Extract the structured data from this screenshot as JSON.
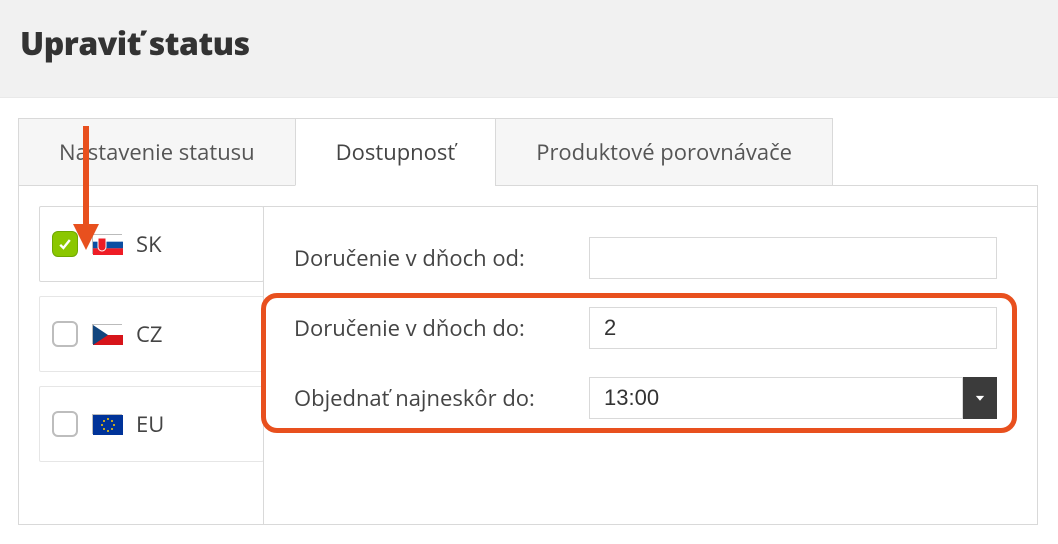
{
  "header": {
    "title": "Upraviť status"
  },
  "tabs": {
    "status": {
      "label": "Nastavenie statusu",
      "active": false
    },
    "avail": {
      "label": "Dostupnosť",
      "active": true
    },
    "compare": {
      "label": "Produktové porovnávače",
      "active": false
    }
  },
  "countries": [
    {
      "code": "SK",
      "checked": true
    },
    {
      "code": "CZ",
      "checked": false
    },
    {
      "code": "EU",
      "checked": false
    }
  ],
  "form": {
    "delivery_from": {
      "label": "Doručenie v dňoch od:",
      "value": ""
    },
    "delivery_to": {
      "label": "Doručenie v dňoch do:",
      "value": "2"
    },
    "order_until": {
      "label": "Objednať najneskôr do:",
      "value": "13:00"
    }
  },
  "colors": {
    "accent_highlight": "#e8501e",
    "checkbox_on": "#8bc700"
  }
}
